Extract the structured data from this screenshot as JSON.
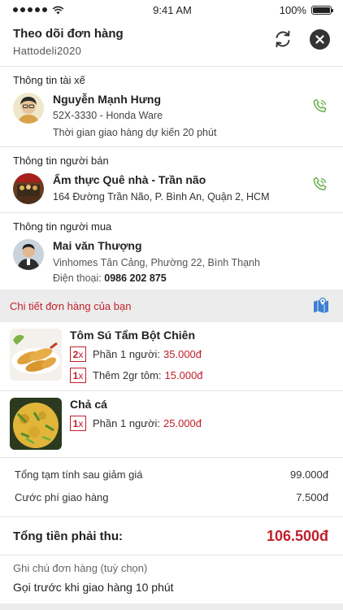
{
  "status_bar": {
    "time": "9:41 AM",
    "battery": "100%"
  },
  "header": {
    "title": "Theo dõi đơn hàng",
    "subtitle": "Hattodeli2020"
  },
  "driver": {
    "section_label": "Thông tin tài xế",
    "name": "Nguyễn Mạnh Hưng",
    "vehicle": "52X-3330 - Honda Ware",
    "eta": "Thời gian giao hàng dự kiến 20 phút"
  },
  "seller": {
    "section_label": "Thông tin người bán",
    "name": "Ẩm thực Quê nhà - Trần não",
    "address": "164 Đường Trần Não, P. Bình An, Quận 2, HCM"
  },
  "buyer": {
    "section_label": "Thông tin người mua",
    "name": "Mai văn Thượng",
    "address": "Vinhomes Tân Cảng, Phường 22, Bình Thạnh",
    "phone_label": "Điện thoại:",
    "phone": "0986 202 875"
  },
  "order_detail": {
    "title": "Chi tiết đơn hàng của bạn"
  },
  "items": [
    {
      "name": "Tôm Sú Tẩm Bột Chiên",
      "options": [
        {
          "qty": "2",
          "qty_suffix": "x",
          "label": "Phần 1 người:",
          "price": "35.000đ"
        },
        {
          "qty": "1",
          "qty_suffix": "x",
          "label": "Thêm 2gr tôm:",
          "price": "15.000đ"
        }
      ]
    },
    {
      "name": "Chả cá",
      "options": [
        {
          "qty": "1",
          "qty_suffix": "x",
          "label": "Phần 1 người:",
          "price": "25.000đ"
        }
      ]
    }
  ],
  "summary": {
    "subtotal_label": "Tổng tạm tính sau giảm giá",
    "subtotal_value": "99.000đ",
    "shipping_label": "Cước phí giao hàng",
    "shipping_value": "7.500đ",
    "total_label": "Tổng tiền phải thu:",
    "total_value": "106.500đ"
  },
  "note": {
    "label": "Ghi chú đơn hàng (tuỳ chọn)",
    "text": "Gọi trước khi giao hàng 10 phút"
  },
  "colors": {
    "accent": "#c0202a",
    "phone_icon": "#6ab04c",
    "map_icon": "#3d7fd1"
  },
  "icons": {
    "refresh": "refresh-icon",
    "close": "close-icon",
    "phone": "phone-icon",
    "map": "map-icon",
    "wifi": "wifi-icon",
    "battery": "battery-icon"
  }
}
